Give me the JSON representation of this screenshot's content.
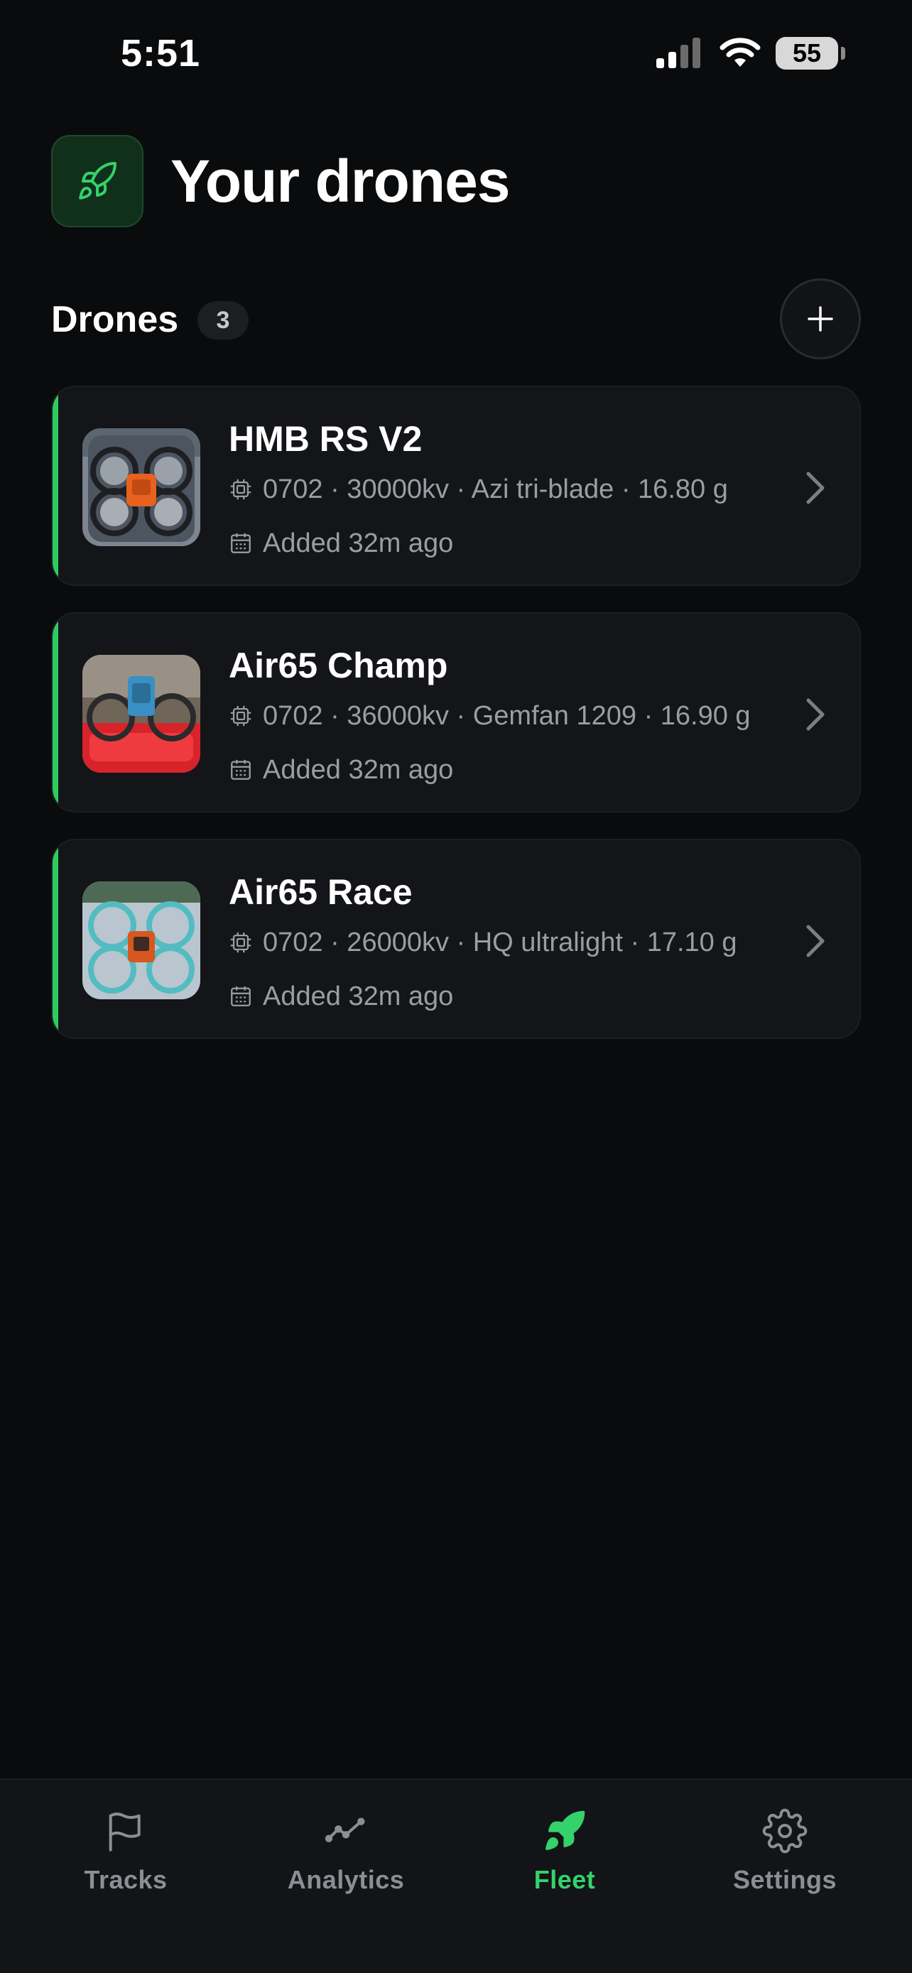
{
  "status_bar": {
    "time": "5:51",
    "battery": "55"
  },
  "header": {
    "title": "Your drones",
    "icon": "rocket-icon"
  },
  "section": {
    "title": "Drones",
    "count": "3"
  },
  "drones": [
    {
      "name": "HMB RS V2",
      "specs": "0702 · 30000kv · Azi tri-blade · 16.80 g",
      "added": "Added 32m ago"
    },
    {
      "name": "Air65 Champ",
      "specs": "0702 · 36000kv · Gemfan 1209 · 16.90 g",
      "added": "Added 32m ago"
    },
    {
      "name": "Air65 Race",
      "specs": "0702 · 26000kv · HQ ultralight · 17.10 g",
      "added": "Added 32m ago"
    }
  ],
  "tabs": [
    {
      "label": "Tracks",
      "icon": "flag-icon"
    },
    {
      "label": "Analytics",
      "icon": "analytics-icon"
    },
    {
      "label": "Fleet",
      "icon": "rocket-icon",
      "active": true
    },
    {
      "label": "Settings",
      "icon": "gear-icon"
    }
  ],
  "colors": {
    "background": "#0a0b0d",
    "card": "#141518",
    "accent": "#2ecc5f",
    "muted_text": "#9c9da3"
  }
}
